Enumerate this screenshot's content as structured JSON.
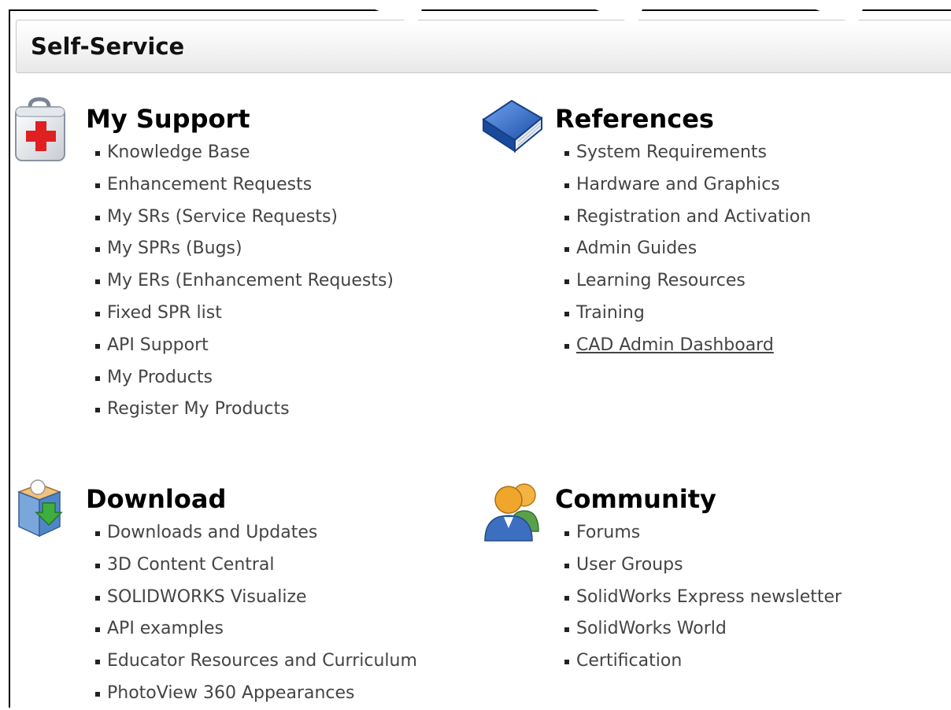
{
  "page": {
    "title": "Self-Service"
  },
  "sections": {
    "support": {
      "heading": "My Support",
      "icon": "first-aid-kit-icon",
      "links": [
        "Knowledge Base",
        "Enhancement Requests",
        "My SRs (Service Requests)",
        "My SPRs (Bugs)",
        "My ERs (Enhancement Requests)",
        "Fixed SPR list",
        "API Support",
        "My Products",
        "Register My Products"
      ]
    },
    "references": {
      "heading": "References",
      "icon": "blue-book-icon",
      "links": [
        "System Requirements",
        "Hardware and Graphics",
        "Registration and Activation",
        "Admin Guides",
        "Learning Resources",
        "Training",
        "CAD Admin Dashboard"
      ]
    },
    "download": {
      "heading": "Download",
      "icon": "download-box-icon",
      "links": [
        "Downloads and Updates",
        "3D Content Central",
        "SOLIDWORKS Visualize",
        "API examples",
        "Educator Resources and Curriculum",
        "PhotoView 360 Appearances"
      ]
    },
    "community": {
      "heading": "Community",
      "icon": "users-group-icon",
      "links": [
        "Forums",
        "User Groups",
        "SolidWorks Express newsletter",
        "SolidWorks World",
        "Certification"
      ]
    }
  },
  "colors": {
    "link_text": "#444444",
    "heading_text": "#000000",
    "kit_red": "#e02020",
    "book_blue": "#1f5fbf",
    "people_orange": "#e8961e"
  }
}
